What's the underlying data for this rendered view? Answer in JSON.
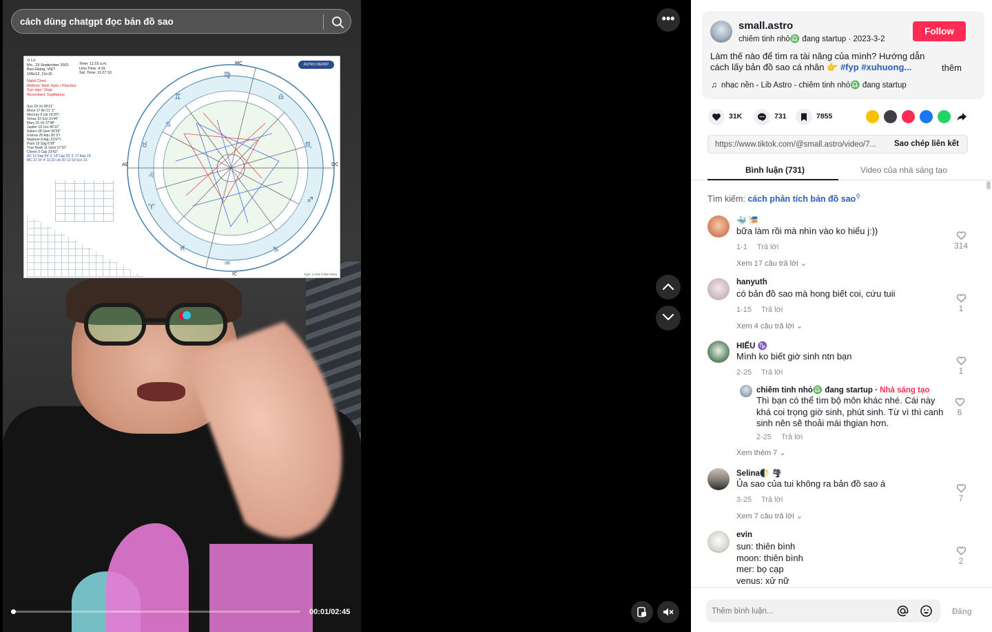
{
  "video": {
    "search_value": "cách dùng chatgpt đọc bản đồ sao",
    "time": "00:01/02:45",
    "progress": 0.006,
    "chart": {
      "meta_lines": [
        "Lo",
        "Mo., 23 September 2002",
        "Bao-Giang, VIET",
        "106e12, 21n16"
      ],
      "meta_red_lines": [
        "Natal Chart",
        "Method: Web Style / Placidus",
        "Sun sign: Virgo",
        "Ascendant: Sagittarius"
      ],
      "time_lines": [
        "Time:        11:15 a.m.",
        "Univ.Time:   4:15",
        "Sid. Time:   11:27:10"
      ],
      "planet_lines": [
        "Sun      29 Vir 58'21\"",
        "Moon     17 Ari 21' 2\"",
        "Mercury   9 Lib 19'29\"r",
        "Venus    10 Sco 21'40\"",
        "Mars     15 Vir 37'48\"",
        "Jupiter  10 Leo 46'12\"",
        "Saturn   28 Gem 46'30\"",
        "Uranus   25 Aqu 36' 0\"r",
        "Neptune   8 Aqu 23'47\"r",
        "Pluto    15 Sag 6'39\"",
        "True Node 11 Gem 17'16\"",
        "Chiron    3 Cap 23'43\"",
        "AC 13 Sag 54'  2: 14 Cap 20'  3: 17 Aqu 15'",
        "MC 21 Vir 4'  11:22 Lib 20'  12:19 Sco 31'"
      ],
      "logo": "ASTRO DIENST",
      "asc_label": "AC",
      "dsc_label": "DC",
      "mc_label": "MC",
      "ic_label": "IC",
      "footer": "Type: 2.GW   2-Mar-2023"
    }
  },
  "author": {
    "username": "small.astro",
    "display_name": "chiêm tinh nhỏ♎ đang startup",
    "date": "2023-3-2",
    "follow_label": "Follow",
    "description": "Làm thế nào để tìm ra tài năng của mình? Hướng dẫn cách lấy bản đồ sao cá nhân 👉",
    "hashtags": "#fyp #xuhuong...",
    "more_label": "thêm",
    "music": "nhạc nền - Lib Astro - chiêm tinh nhỏ♎ đang startup"
  },
  "stats": {
    "likes": "31K",
    "comments": "731",
    "saves": "7855"
  },
  "link": {
    "url": "https://www.tiktok.com/@small.astro/video/7...",
    "copy_label": "Sao chép liên kết"
  },
  "tabs": {
    "comments_label": "Bình luận (731)",
    "creator_videos_label": "Video của nhà sáng tạo"
  },
  "search_suggest": {
    "prefix": "Tìm kiếm:",
    "keyword": "cách phân tích bản đồ sao"
  },
  "comments": [
    {
      "name": "🐳 🎏",
      "text": "bữa làm rồi mà nhìn vào ko hiểu j:))",
      "date": "1-1",
      "reply_label": "Trả lời",
      "likes": "314",
      "view_replies": "Xem 17 câu trả lời"
    },
    {
      "name": "hanyuth",
      "text": "có bản đồ sao mà hong biết coi, cứu tuii",
      "date": "1-15",
      "reply_label": "Trả lời",
      "likes": "1",
      "view_replies": "Xem 4 câu trả lời"
    },
    {
      "name": "HIẾU ♑",
      "text": "Mình ko biết giờ sinh ntn bạn",
      "date": "2-25",
      "reply_label": "Trả lời",
      "likes": "1",
      "view_replies": "Xem thêm 7"
    },
    {
      "name": "Selina🌓 🌪",
      "text": "Ủa sao của tui không ra bản đồ sao á",
      "date": "3-25",
      "reply_label": "Trả lời",
      "likes": "7",
      "view_replies": "Xem 7 câu trả lời"
    },
    {
      "name": "evin",
      "lines": [
        "sun: thiên bình",
        "moon: thiên bình",
        "mer: bọ cạp",
        "venus: xử nữ"
      ],
      "likes": "2"
    }
  ],
  "reply": {
    "name": "chiêm tinh nhỏ♎ đang startup",
    "creator_badge": "Nhà sáng tạo",
    "text": "Thì bạn có thể tìm bộ môn khác nhé. Cái này khá coi trọng giờ sinh, phút sinh. Từ vì thì canh sinh nên sẽ thoải mái thgian hơn.",
    "date": "2-25",
    "reply_label": "Trả lời",
    "likes": "6"
  },
  "composer": {
    "placeholder": "Thêm bình luận...",
    "post_label": "Đăng"
  },
  "colors": {
    "accent": "#fe2c55",
    "link": "#2b5db9",
    "text": "#161823"
  }
}
